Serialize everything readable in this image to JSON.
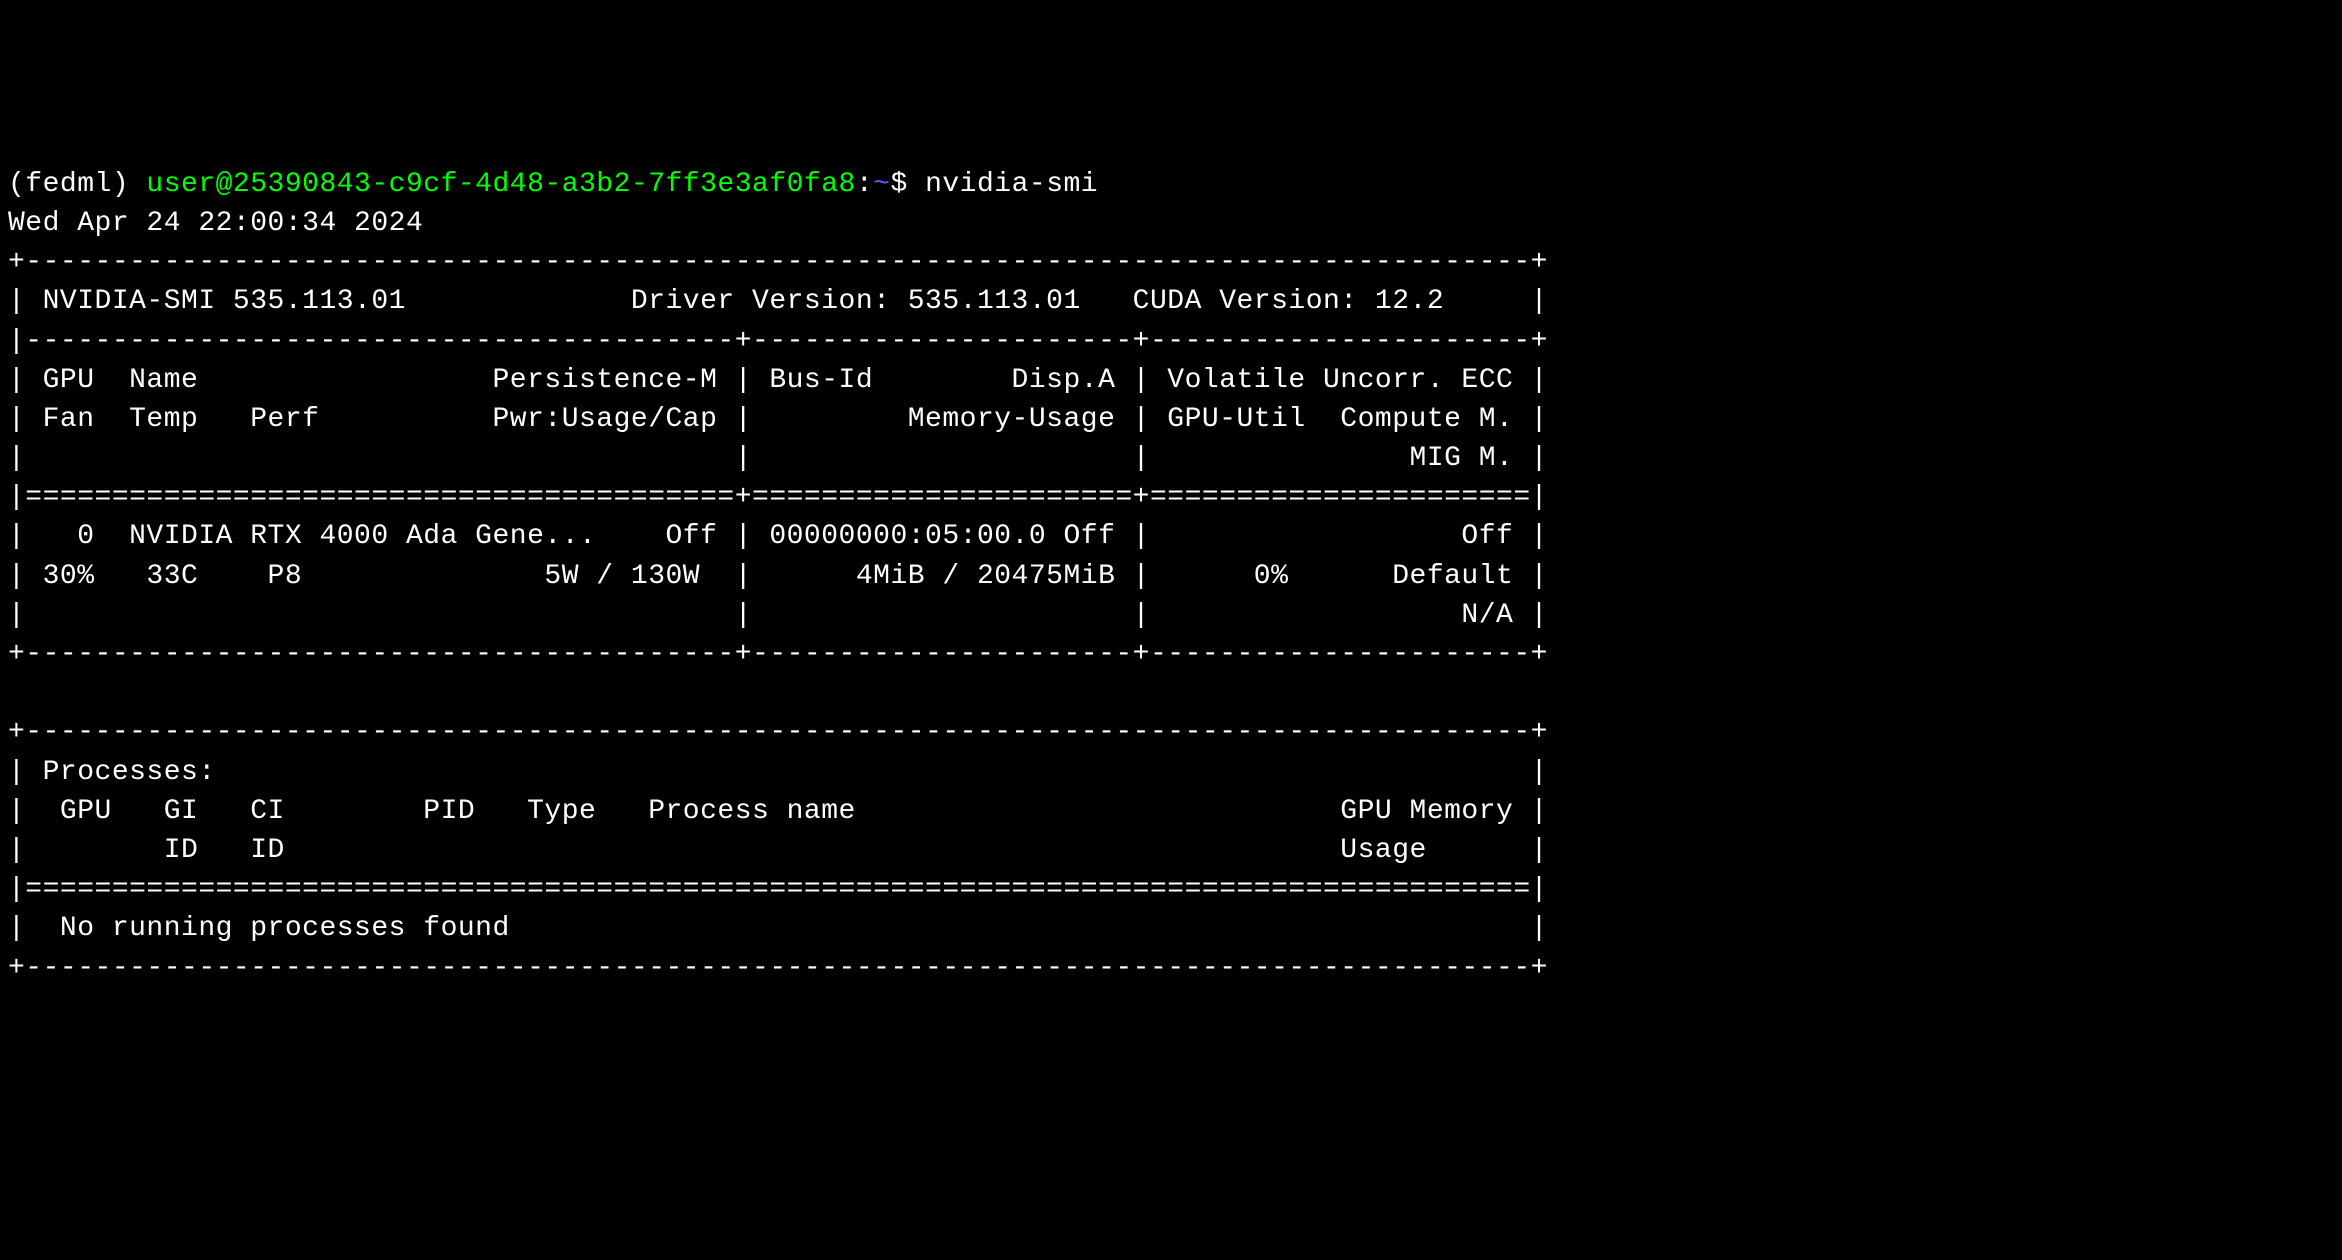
{
  "prompt": {
    "env": "(fedml) ",
    "user_host": "user@25390843-c9cf-4d48-a3b2-7ff3e3af0fa8",
    "colon": ":",
    "path": "~",
    "dollar": "$ ",
    "command": "nvidia-smi"
  },
  "timestamp": "Wed Apr 24 22:00:34 2024",
  "smi": {
    "version": "535.113.01",
    "driver_version": "535.113.01",
    "cuda_version": "12.2",
    "gpu": {
      "index": "0",
      "name": "NVIDIA RTX 4000 Ada Gene...",
      "persistence_m": "Off",
      "bus_id": "00000000:05:00.0",
      "disp_a": "Off",
      "fan": "30%",
      "temp": "33C",
      "perf": "P8",
      "pwr_usage": "5W",
      "pwr_cap": "130W",
      "mem_used": "4MiB",
      "mem_total": "20475MiB",
      "volatile_ecc": "Off",
      "gpu_util": "0%",
      "compute_m": "Default",
      "mig_m": "N/A"
    },
    "processes": {
      "message": "No running processes found"
    }
  },
  "lines": {
    "l00": "(fedml) user@25390843-c9cf-4d48-a3b2-7ff3e3af0fa8:~$ nvidia-smi",
    "l01": "Wed Apr 24 22:00:34 2024",
    "l02": "+---------------------------------------------------------------------------------------+",
    "l03": "| NVIDIA-SMI 535.113.01             Driver Version: 535.113.01   CUDA Version: 12.2     |",
    "l04": "|-----------------------------------------+----------------------+----------------------+",
    "l05": "| GPU  Name                 Persistence-M | Bus-Id        Disp.A | Volatile Uncorr. ECC |",
    "l06": "| Fan  Temp   Perf          Pwr:Usage/Cap |         Memory-Usage | GPU-Util  Compute M. |",
    "l07": "|                                         |                      |               MIG M. |",
    "l08": "|=========================================+======================+======================|",
    "l09": "|   0  NVIDIA RTX 4000 Ada Gene...    Off | 00000000:05:00.0 Off |                  Off |",
    "l10": "| 30%   33C    P8              5W / 130W  |      4MiB / 20475MiB |      0%      Default |",
    "l11": "|                                         |                      |                  N/A |",
    "l12": "+-----------------------------------------+----------------------+----------------------+",
    "l13": "                                                                                         ",
    "l14": "+---------------------------------------------------------------------------------------+",
    "l15": "| Processes:                                                                            |",
    "l16": "|  GPU   GI   CI        PID   Type   Process name                            GPU Memory |",
    "l17": "|        ID   ID                                                             Usage      |",
    "l18": "|=======================================================================================|",
    "l19": "|  No running processes found                                                           |",
    "l20": "+---------------------------------------------------------------------------------------+"
  }
}
